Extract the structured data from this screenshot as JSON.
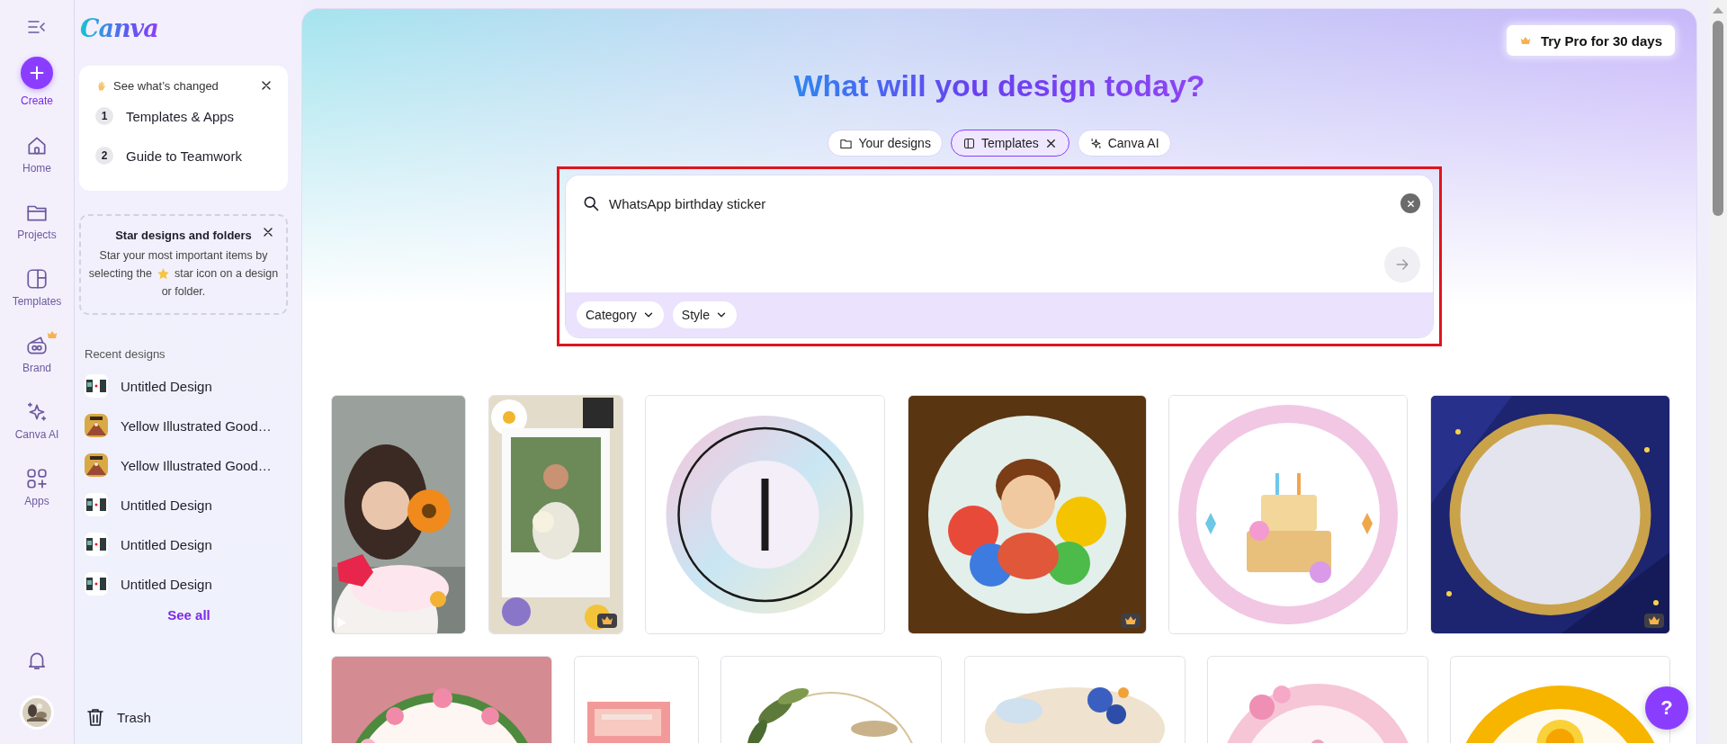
{
  "rail": {
    "items": [
      {
        "kind": "create",
        "label": "Create"
      },
      {
        "kind": "home",
        "label": "Home",
        "selected": false,
        "crown": false
      },
      {
        "kind": "projects",
        "label": "Projects",
        "selected": false,
        "crown": false
      },
      {
        "kind": "templates",
        "label": "Templates",
        "selected": false,
        "crown": false
      },
      {
        "kind": "brand",
        "label": "Brand",
        "selected": false,
        "crown": true
      },
      {
        "kind": "ai",
        "label": "Canva AI",
        "selected": false,
        "crown": false
      },
      {
        "kind": "apps",
        "label": "Apps",
        "selected": false,
        "crown": false
      }
    ]
  },
  "panel": {
    "logo": "Canva",
    "whats_changed": {
      "title": "See what’s changed",
      "steps": [
        {
          "number": "1",
          "label": "Templates & Apps"
        },
        {
          "number": "2",
          "label": "Guide to Teamwork"
        }
      ]
    },
    "star_tip": {
      "title": "Star designs and folders",
      "text_lines": [
        "Star your most important items by",
        "selecting the",
        "star icon on a design",
        "or folder."
      ]
    },
    "recent": {
      "heading": "Recent designs",
      "items": [
        {
          "title": "Untitled Design"
        },
        {
          "title": "Yellow Illustrated Good…"
        },
        {
          "title": "Yellow Illustrated Good…"
        },
        {
          "title": "Untitled Design"
        },
        {
          "title": "Untitled Design"
        },
        {
          "title": "Untitled Design"
        }
      ],
      "see_all": "See all"
    },
    "trash": "Trash"
  },
  "main": {
    "try_pro": "Try Pro for 30 days",
    "title": "What will you design today?",
    "chips": [
      {
        "kind": "designs",
        "label": "Your designs",
        "selected": false
      },
      {
        "kind": "templates",
        "label": "Templates",
        "selected": true
      },
      {
        "kind": "ai",
        "label": "Canva AI",
        "selected": false
      }
    ],
    "search": {
      "value": "WhatsApp birthday sticker"
    },
    "filters": [
      "Category",
      "Style"
    ],
    "template_rows": [
      {
        "cards": [
          {
            "premium": false,
            "video": true
          },
          {
            "premium": true,
            "video": false
          },
          {
            "premium": false,
            "video": false
          },
          {
            "premium": true,
            "video": false
          },
          {
            "premium": false,
            "video": false
          },
          {
            "premium": true,
            "video": false
          }
        ]
      },
      {
        "cards": [
          {
            "premium": false,
            "video": false
          },
          {
            "premium": false,
            "video": false
          },
          {
            "premium": false,
            "video": false
          },
          {
            "premium": false,
            "video": false
          },
          {
            "premium": false,
            "video": false
          },
          {
            "premium": false,
            "video": false
          }
        ]
      }
    ],
    "help_button": "?"
  }
}
